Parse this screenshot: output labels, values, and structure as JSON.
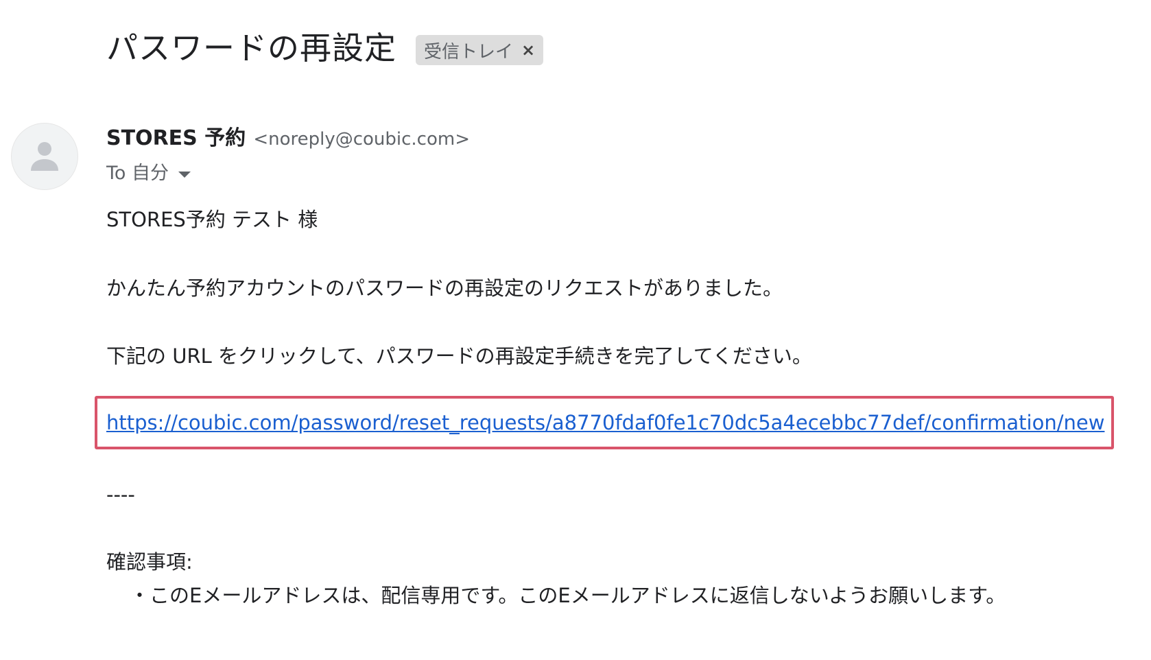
{
  "subject": "パスワードの再設定",
  "label": {
    "name": "受信トレイ",
    "close_glyph": "×"
  },
  "sender": {
    "name": "STORES 予約",
    "email": "<noreply@coubic.com>",
    "to": "To 自分",
    "avatar_icon": "person-icon"
  },
  "body": {
    "greeting": "STORES予約 テスト 様",
    "line1": "かんたん予約アカウントのパスワードの再設定のリクエストがありました。",
    "line2": "下記の URL をクリックして、パスワードの再設定手続きを完了してください。",
    "reset_url": "https://coubic.com/password/reset_requests/a8770fdaf0fe1c70dc5a4ecebbc77def/confirmation/new",
    "separator": "----",
    "notes_heading": "確認事項:",
    "note_item": "・このEメールアドレスは、配信専用です。このEメールアドレスに返信しないようお願いします。"
  },
  "colors": {
    "link": "#1a5fd0",
    "highlight_border": "#d9546a",
    "chip_background": "#dddddd"
  }
}
